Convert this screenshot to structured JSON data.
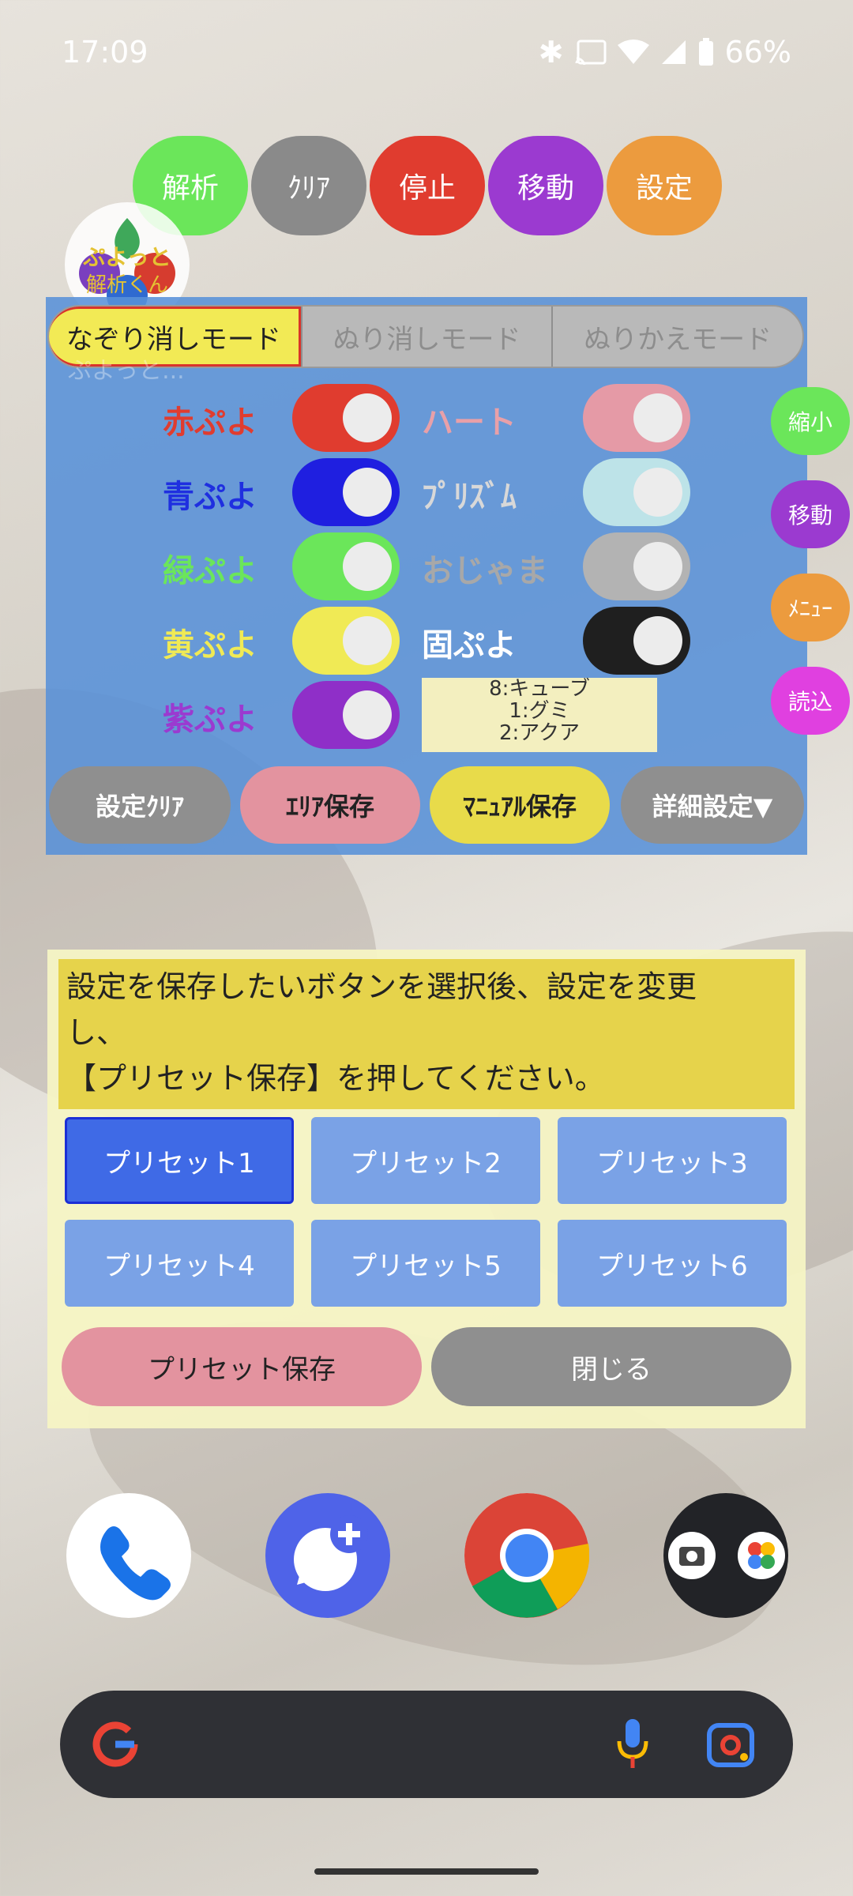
{
  "status_bar": {
    "time": "17:09",
    "battery": "66%",
    "icons": [
      "bluetooth-icon",
      "cast-icon",
      "wifi-icon",
      "signal-icon",
      "battery-icon"
    ]
  },
  "top_buttons": [
    {
      "label": "解析",
      "color": "#6be65a"
    },
    {
      "label": "ｸﾘｱ",
      "color": "#8a8a8a"
    },
    {
      "label": "停止",
      "color": "#e03c2f"
    },
    {
      "label": "移動",
      "color": "#9b3ad0"
    },
    {
      "label": "設定",
      "color": "#ec9b3e"
    }
  ],
  "logo": {
    "text_top": "ぷよっと",
    "text_bottom": "解析くん"
  },
  "modes": [
    {
      "label": "なぞり消しモード",
      "active": true
    },
    {
      "label": "ぬり消しモード",
      "active": false
    },
    {
      "label": "ぬりかえモード",
      "active": false
    }
  ],
  "ghost_text": "ぷよっと...",
  "toggles_left": [
    {
      "label": "赤ぷよ",
      "color": "#e03c2f",
      "track": "#e03c2f"
    },
    {
      "label": "青ぷよ",
      "color": "#1f2fe0",
      "track": "#1f1fe0"
    },
    {
      "label": "緑ぷよ",
      "color": "#6be65a",
      "track": "#6be65a"
    },
    {
      "label": "黄ぷよ",
      "color": "#f0ea55",
      "track": "#f0ea55"
    },
    {
      "label": "紫ぷよ",
      "color": "#9b3ad0",
      "track": "#8f2fc8"
    }
  ],
  "toggles_right": [
    {
      "label": "ハート",
      "color": "#e8a0a8",
      "track": "#e59aa6"
    },
    {
      "label": "ﾌﾟﾘｽﾞﾑ",
      "color": "#d8d8d8",
      "track": "#bde3e8"
    },
    {
      "label": "おじゃま",
      "color": "#a8a8a8",
      "track": "#b3b3b3"
    },
    {
      "label": "固ぷよ",
      "color": "#ffffff",
      "track": "#1f1f1f"
    }
  ],
  "legend_lines": [
    "8:キューブ",
    "1:グミ",
    "2:アクア"
  ],
  "panel_buttons": [
    {
      "label": "設定ｸﾘｱ",
      "color": "#8f8f8f",
      "text": "#ffffff"
    },
    {
      "label": "ｴﾘｱ保存",
      "color": "#e3939f",
      "text": "#222222"
    },
    {
      "label": "ﾏﾆｭｱﾙ保存",
      "color": "#e8db4a",
      "text": "#222222"
    },
    {
      "label": "詳細設定▼",
      "color": "#8f8f8f",
      "text": "#ffffff"
    }
  ],
  "side_buttons": [
    {
      "label": "縮小",
      "color": "#6be65a"
    },
    {
      "label": "移動",
      "color": "#9b3ad0"
    },
    {
      "label": "ﾒﾆｭｰ",
      "color": "#ec9b3e"
    },
    {
      "label": "読込",
      "color": "#e040e0"
    }
  ],
  "preset_dialog": {
    "message_line1": "設定を保存したいボタンを選択後、設定を変更",
    "message_line2": "し、",
    "message_line3": "【プリセット保存】を押してください。",
    "presets": [
      "プリセット1",
      "プリセット2",
      "プリセット3",
      "プリセット4",
      "プリセット5",
      "プリセット6"
    ],
    "selected": "プリセット1",
    "save_label": "プリセット保存",
    "close_label": "閉じる"
  },
  "dock": [
    "phone-icon",
    "messages-icon",
    "chrome-icon",
    "camera-photos-icon"
  ],
  "search": {
    "left_icon": "google-g-icon",
    "mic_icon": "mic-icon",
    "lens_icon": "lens-icon"
  }
}
